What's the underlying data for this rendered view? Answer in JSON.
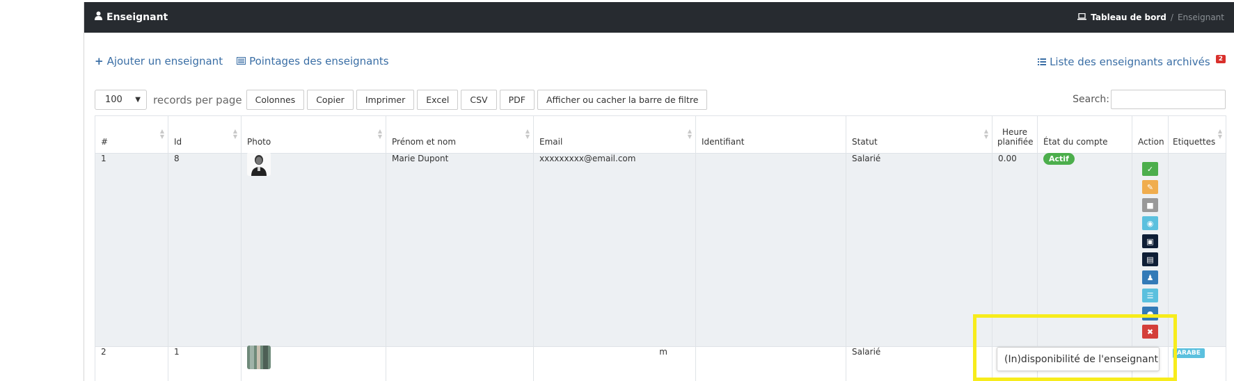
{
  "header": {
    "title": "Enseignant",
    "breadcrumb": [
      "Tableau de bord",
      "Enseignant"
    ]
  },
  "links": {
    "add": "Ajouter un enseignant",
    "pointages": "Pointages des enseignants",
    "archived": "Liste des enseignants archivés",
    "archived_count": "2"
  },
  "controls": {
    "page_size": "100",
    "records_per_page_label": "records per page",
    "buttons": [
      "Colonnes",
      "Copier",
      "Imprimer",
      "Excel",
      "CSV",
      "PDF",
      "Afficher ou cacher la barre de filtre"
    ],
    "search_label": "Search:"
  },
  "table": {
    "headers": [
      "#",
      "Id",
      "Photo",
      "Prénom et nom",
      "Email",
      "Identifiant",
      "Statut",
      "Heure planifiée",
      "État du compte",
      "Action",
      "Etiquettes"
    ],
    "rows": [
      {
        "num": "1",
        "id": "8",
        "name": "Marie Dupont",
        "email": "xxxxxxxxx@email.com",
        "identifiant": "",
        "statut": "Salarié",
        "heure": "0.00",
        "etat": "Actif",
        "etiquette": ""
      },
      {
        "num": "2",
        "id": "1",
        "name": "",
        "email": "m",
        "identifiant": "",
        "statut": "Salarié",
        "heure": "",
        "etat": "",
        "etiquette": "ARABE"
      }
    ]
  },
  "tooltip": {
    "text": "(In)disponibilité de l'enseignant"
  },
  "colors": {
    "header_bg": "#272b30",
    "link": "#3a6ea5",
    "active_badge": "#4cae4c",
    "highlight": "#f7ec1c"
  }
}
